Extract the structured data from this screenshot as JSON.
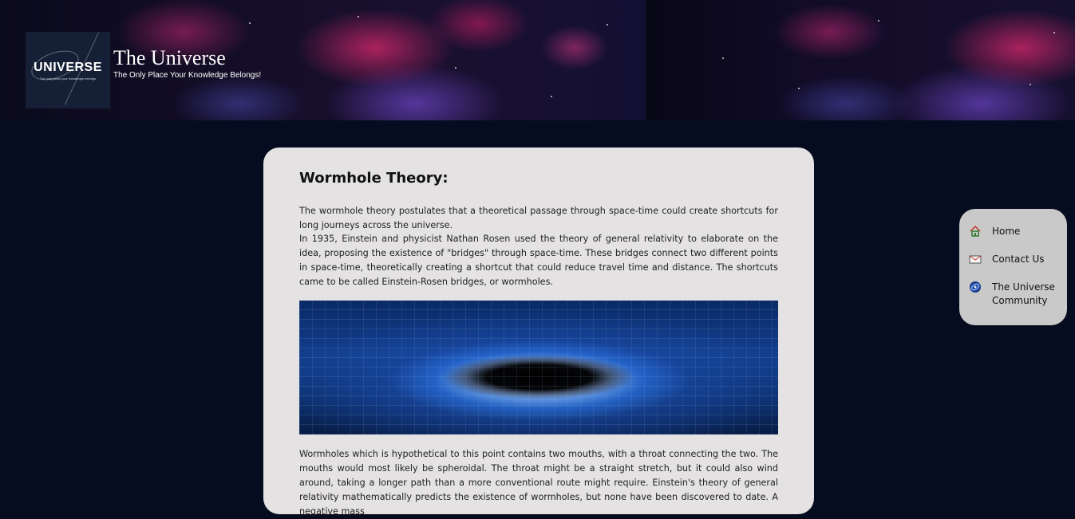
{
  "header": {
    "logo_word": "UNIVERSE",
    "logo_sub": "The only place your knowledge belongs",
    "title": "The Universe",
    "tagline": "The Only Place Your Knowledge Belongs!"
  },
  "article": {
    "title": "Wormhole Theory:",
    "paragraphs": [
      "The wormhole theory postulates that a theoretical passage through space-time could create shortcuts for long journeys across the universe.",
      "In 1935, Einstein and physicist Nathan Rosen used the theory of general relativity to elaborate on the idea, proposing the existence of \"bridges\" through space-time. These bridges connect two different points in space-time, theoretically creating a shortcut that could reduce travel time and distance. The shortcuts came to be called Einstein-Rosen bridges, or wormholes.",
      "Wormholes which is hypothetical to this point contains two mouths, with a throat connecting the two. The mouths would most likely be spheroidal. The throat might be a straight stretch, but it could also wind around, taking a longer path than a more conventional route might require. Einstein's theory of general relativity mathematically predicts the existence of wormholes, but none have been discovered to date. A negative mass"
    ],
    "image_alt": "wormhole illustration"
  },
  "sidenav": {
    "items": [
      {
        "label": "Home",
        "icon": "home-icon"
      },
      {
        "label": "Contact Us",
        "icon": "envelope-icon"
      },
      {
        "label": "The Universe Community",
        "icon": "galaxy-icon"
      }
    ]
  },
  "colors": {
    "page_bg": "#060c1f",
    "card_bg": "#e4e2e3",
    "nav_bg": "#c9c9c9"
  }
}
